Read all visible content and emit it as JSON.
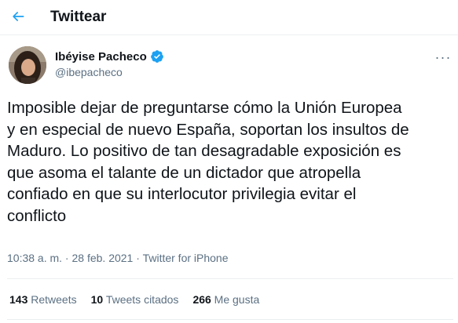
{
  "header": {
    "title": "Twittear",
    "back_icon": "arrow-left-icon"
  },
  "author": {
    "name": "Ibéyise Pacheco",
    "handle": "@ibepacheco",
    "verified_icon": "verified-badge-icon"
  },
  "tweet": {
    "lines": [
      "Imposible dejar de preguntarse cómo la Unión Europea",
      "y en especial de nuevo España, soportan los insultos de",
      "Maduro. Lo positivo de tan desagradable exposición es",
      "que asoma el talante de un dictador que atropella",
      "confiado en que su interlocutor privilegia evitar el",
      "conflicto"
    ],
    "time": "10:38 a. m.",
    "separator": " · ",
    "date": "28 feb. 2021",
    "source": "Twitter for iPhone"
  },
  "stats": {
    "retweets_count": "143",
    "retweets_label": " Retweets",
    "quotes_count": "10",
    "quotes_label": " Tweets citados",
    "likes_count": "266",
    "likes_label": " Me gusta"
  },
  "colors": {
    "accent": "#1da1f2",
    "text": "#0f1419",
    "secondary": "#5b7083",
    "border": "#ebeef0"
  }
}
